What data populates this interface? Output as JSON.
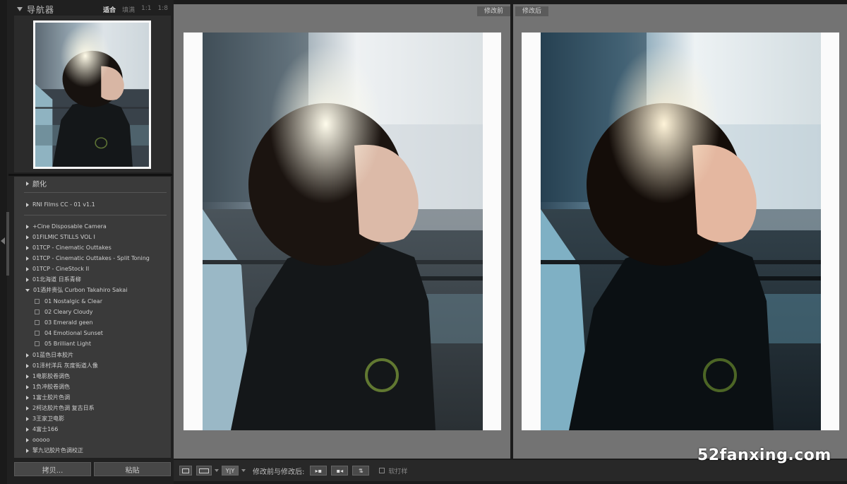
{
  "navigator": {
    "title": "导航器",
    "zoom_options": [
      "适合",
      "填满",
      "1:1",
      "1:8"
    ],
    "active_zoom": "适合"
  },
  "presets": {
    "groups": [
      {
        "label": "颜化",
        "kind": "group"
      },
      {
        "label": "RNI Films CC - 01 v1.1",
        "kind": "group"
      },
      {
        "label": "+Cine Disposable Camera",
        "kind": "group"
      },
      {
        "label": "01FILMIC STILLS VOL I",
        "kind": "group"
      },
      {
        "label": "01TCP - Cinematic Outtakes",
        "kind": "group"
      },
      {
        "label": "01TCP - Cinematic Outtakes - Split Toning",
        "kind": "group"
      },
      {
        "label": "01TCP - CineStock II",
        "kind": "group"
      },
      {
        "label": "01北海道 日系青柳",
        "kind": "group"
      },
      {
        "label": "01酒井贵弘 Curbon Takahiro Sakai",
        "kind": "open"
      },
      {
        "label": "01 Nostalgic & Clear",
        "kind": "item"
      },
      {
        "label": "02 Cleary Cloudy",
        "kind": "item"
      },
      {
        "label": "03 Emerald geen",
        "kind": "item"
      },
      {
        "label": "04 Emotional Sunset",
        "kind": "item"
      },
      {
        "label": "05 Brilliant Light",
        "kind": "item"
      },
      {
        "label": "01蓝色日本胶片",
        "kind": "group"
      },
      {
        "label": "01泽村洋兵 灰度街道人像",
        "kind": "group"
      },
      {
        "label": "1电影胶卷调色",
        "kind": "group"
      },
      {
        "label": "1负冲胶卷调色",
        "kind": "group"
      },
      {
        "label": "1富士胶片色调",
        "kind": "group"
      },
      {
        "label": "2柯达胶片色调 复古日系",
        "kind": "group"
      },
      {
        "label": "3王家卫电影",
        "kind": "group"
      },
      {
        "label": "4富士166",
        "kind": "group"
      },
      {
        "label": "ooooo",
        "kind": "group"
      },
      {
        "label": "擎九记胶片色调校正",
        "kind": "group"
      }
    ],
    "copy_button": "拷贝...",
    "paste_button": "粘贴"
  },
  "compare": {
    "before_label": "修改前",
    "after_label": "修改后"
  },
  "toolbar": {
    "view_mode_label": "Y|Y",
    "compare_label": "修改前与修改后:",
    "soft_proof_label": "软打样"
  },
  "watermark": "52fanxing.com",
  "colors": {
    "panel_bg": "#202020",
    "preset_bg": "#3a3a3a",
    "compare_bg": "#737373",
    "toolbar_bg": "#282828"
  }
}
